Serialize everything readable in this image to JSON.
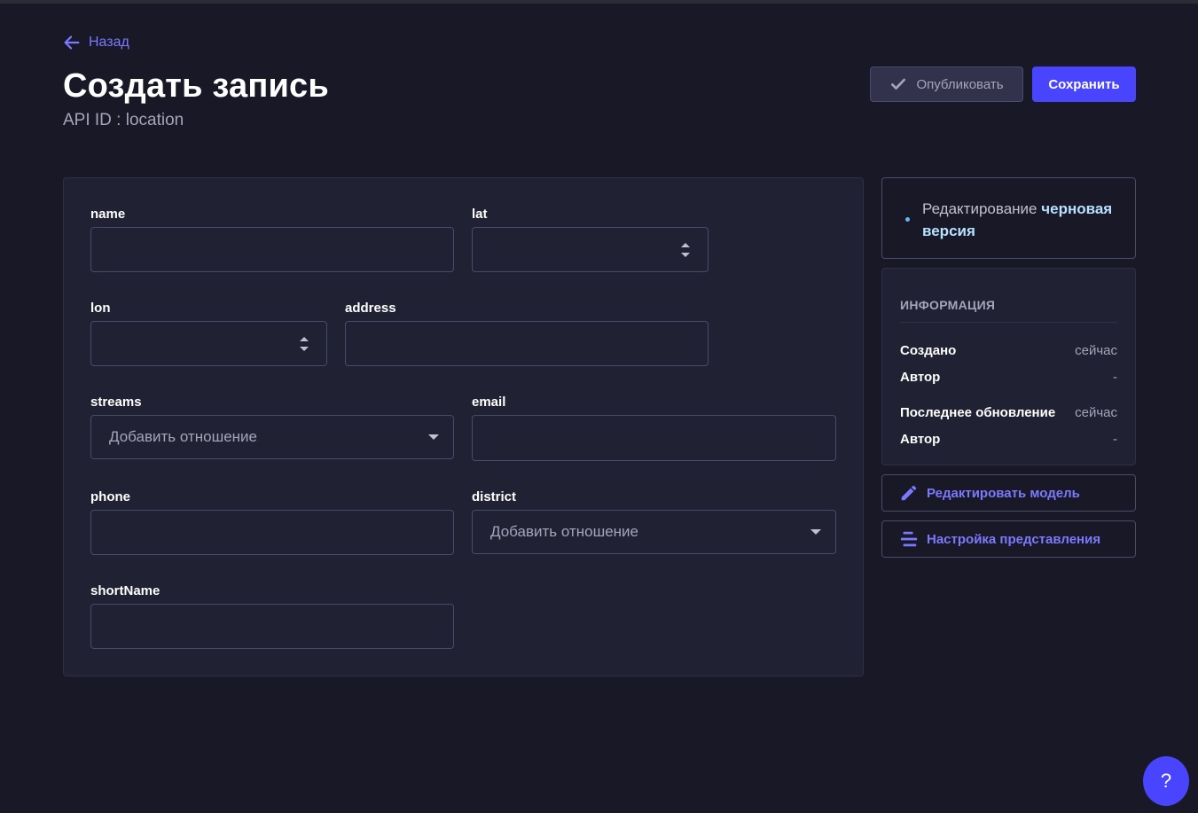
{
  "header": {
    "back_label": "Назад",
    "title": "Создать запись",
    "subtitle": "API ID : location",
    "publish_label": "Опубликовать",
    "save_label": "Сохранить"
  },
  "fields": {
    "name": {
      "label": "name",
      "value": ""
    },
    "lat": {
      "label": "lat",
      "value": ""
    },
    "lon": {
      "label": "lon",
      "value": ""
    },
    "address": {
      "label": "address",
      "value": ""
    },
    "streams": {
      "label": "streams",
      "placeholder": "Добавить отношение"
    },
    "email": {
      "label": "email",
      "value": ""
    },
    "phone": {
      "label": "phone",
      "value": ""
    },
    "district": {
      "label": "district",
      "placeholder": "Добавить отношение"
    },
    "shortName": {
      "label": "shortName",
      "value": ""
    }
  },
  "status": {
    "prefix": "Редактирование",
    "state": "черновая версия"
  },
  "info": {
    "title": "ИНФОРМАЦИЯ",
    "created_label": "Создано",
    "created_value": "сейчас",
    "author1_label": "Автор",
    "author1_value": "-",
    "updated_label": "Последнее обновление",
    "updated_value": "сейчас",
    "author2_label": "Автор",
    "author2_value": "-"
  },
  "actions": {
    "edit_model": "Редактировать модель",
    "configure_view": "Настройка представления"
  },
  "help": {
    "label": "?"
  },
  "colors": {
    "background": "#181826",
    "card": "#212134",
    "accent": "#4945ff",
    "link": "#7b79ff"
  },
  "icons": [
    "arrow-left-icon",
    "check-icon",
    "pencil-icon",
    "layout-icon",
    "spinner-arrows-icon",
    "caret-down-icon"
  ]
}
